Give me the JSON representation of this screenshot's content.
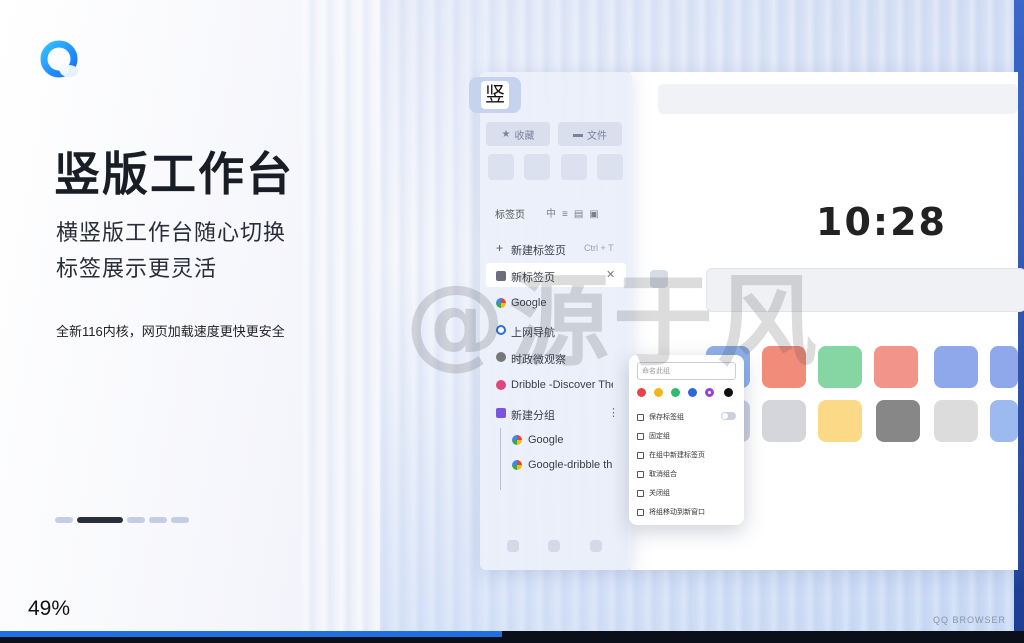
{
  "hero": {
    "title": "竖版工作台",
    "subtitle_line1": "横竖版工作台随心切换",
    "subtitle_line2": "标签展示更灵活",
    "description": "全新116内核，网页加载速度更快更安全"
  },
  "loading": {
    "percent_text": "49%",
    "progress_fraction": 0.49
  },
  "brand": "QQ BROWSER",
  "watermark": "@源于风",
  "colors": {
    "accent": "#1e6fe0",
    "logo_blue": "#1a8cff"
  },
  "carousel": {
    "slide_count": 5,
    "active_index": 1
  },
  "sidebar": {
    "badge": "竖",
    "favorites_label": "收藏",
    "files_label": "文件",
    "tabs_header": "标签页",
    "new_tab_label": "新建标签页",
    "new_tab_shortcut": "Ctrl + T",
    "items": [
      {
        "label": "新标签页",
        "icon": "tab-icon"
      },
      {
        "label": "Google",
        "icon": "google-icon"
      },
      {
        "label": "上网导航",
        "icon": "qq-icon"
      },
      {
        "label": "时政微观察",
        "icon": "news-icon"
      },
      {
        "label": "Dribble -Discover The",
        "icon": "dribbble-icon"
      }
    ],
    "group": {
      "label": "新建分组",
      "children": [
        {
          "label": "Google",
          "icon": "google-icon"
        },
        {
          "label": "Google-dribble th",
          "icon": "google-icon"
        }
      ]
    }
  },
  "newtab": {
    "clock": "10:28"
  },
  "popup": {
    "name_placeholder": "命名此组",
    "colors": [
      "#e64545",
      "#f2b51b",
      "#2dbd6e",
      "#2f67d8",
      "#9b3fd9",
      "#111111"
    ],
    "items": [
      {
        "label": "保存标签组",
        "icon": "save-icon"
      },
      {
        "label": "固定组",
        "icon": "pin-icon"
      },
      {
        "label": "在组中新建标签页",
        "icon": "new-tab-icon"
      },
      {
        "label": "取消组合",
        "icon": "ungroup-icon"
      },
      {
        "label": "关闭组",
        "icon": "close-group-icon"
      },
      {
        "label": "将组移动到新窗口",
        "icon": "move-window-icon"
      }
    ]
  }
}
